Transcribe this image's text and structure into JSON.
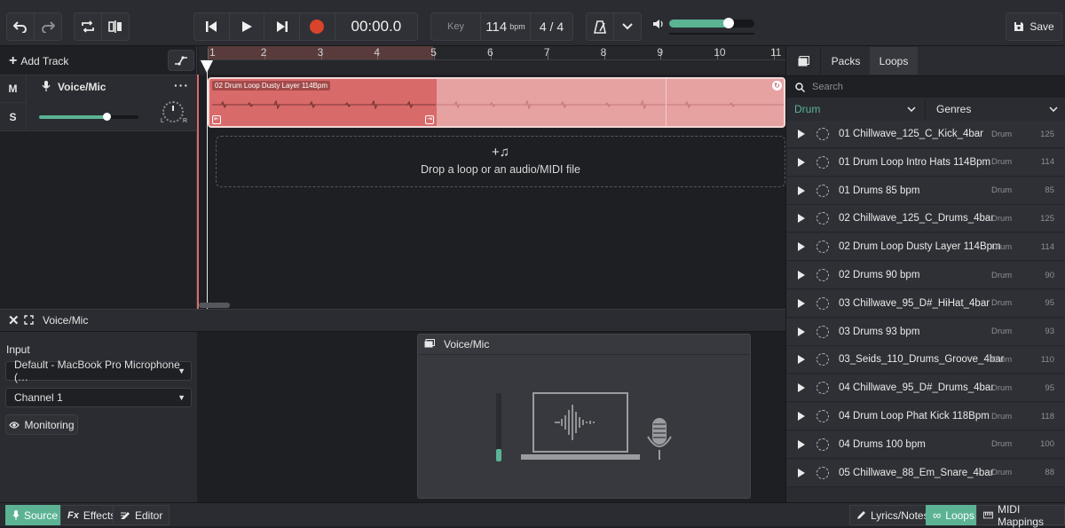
{
  "toolbar": {
    "time": "00:00.0",
    "key_label": "Key",
    "bpm_value": "114",
    "bpm_unit": "bpm",
    "time_signature": "4 / 4",
    "save_label": "Save",
    "volume": 0.7,
    "accent": "#5bb394"
  },
  "tracks": {
    "add_track_label": "Add Track",
    "mute_label": "M",
    "solo_label": "S",
    "track_name": "Voice/Mic",
    "pan_left": "L",
    "pan_right": "R",
    "track_volume": 0.68
  },
  "timeline": {
    "bars": [
      "1",
      "2",
      "3",
      "4",
      "5",
      "6",
      "7",
      "8",
      "9",
      "10",
      "11"
    ],
    "clip_name": "02 Drum Loop Dusty Layer 114Bpm",
    "drop_text": "Drop a loop or an audio/MIDI file",
    "clip_color": "#d96a6a"
  },
  "panel": {
    "title": "Voice/Mic",
    "input_label": "Input",
    "input_device": "Default - MacBook Pro Microphone (…",
    "channel": "Channel 1",
    "monitoring_label": "Monitoring",
    "card_title": "Voice/Mic"
  },
  "bottom": {
    "source_label": "Source",
    "effects_label": "Effects",
    "editor_label": "Editor",
    "lyrics_label": "Lyrics/Notes",
    "loops_label": "Loops",
    "midi_label": "MIDI Mappings"
  },
  "browser": {
    "tab_packs": "Packs",
    "tab_loops": "Loops",
    "search_placeholder": "Search",
    "filter_instrument": "Drum",
    "filter_genres": "Genres",
    "loops": [
      {
        "name": "01 Chillwave_125_C_Kick_4bar",
        "genre": "Drum",
        "bpm": "125"
      },
      {
        "name": "01 Drum Loop Intro Hats 114Bpm",
        "genre": "Drum",
        "bpm": "114"
      },
      {
        "name": "01 Drums 85 bpm",
        "genre": "Drum",
        "bpm": "85"
      },
      {
        "name": "02 Chillwave_125_C_Drums_4bar",
        "genre": "Drum",
        "bpm": "125"
      },
      {
        "name": "02 Drum Loop Dusty Layer 114Bpm",
        "genre": "Drum",
        "bpm": "114"
      },
      {
        "name": "02 Drums 90 bpm",
        "genre": "Drum",
        "bpm": "90"
      },
      {
        "name": "03 Chillwave_95_D#_HiHat_4bar",
        "genre": "Drum",
        "bpm": "95"
      },
      {
        "name": "03 Drums 93 bpm",
        "genre": "Drum",
        "bpm": "93"
      },
      {
        "name": "03_Seids_110_Drums_Groove_4bar",
        "genre": "Drum",
        "bpm": "110"
      },
      {
        "name": "04 Chillwave_95_D#_Drums_4bar",
        "genre": "Drum",
        "bpm": "95"
      },
      {
        "name": "04 Drum Loop Phat Kick 118Bpm",
        "genre": "Drum",
        "bpm": "118"
      },
      {
        "name": "04 Drums 100 bpm",
        "genre": "Drum",
        "bpm": "100"
      },
      {
        "name": "05 Chillwave_88_Em_Snare_4bar",
        "genre": "Drum",
        "bpm": "88"
      }
    ]
  }
}
